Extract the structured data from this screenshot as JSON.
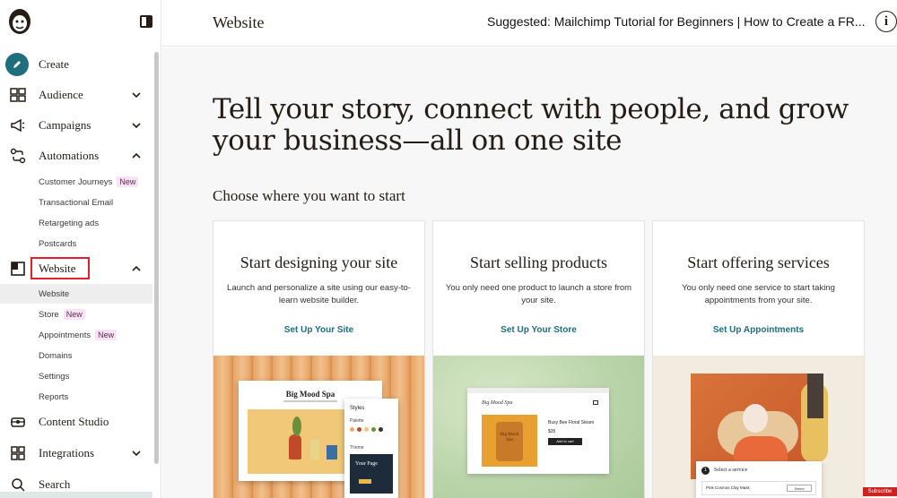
{
  "header": {
    "page_title": "Website",
    "suggested": "Suggested: Mailchimp Tutorial for Beginners | How to Create a FR...",
    "info_label": "i"
  },
  "sidebar": {
    "create": "Create",
    "audience": "Audience",
    "campaigns": "Campaigns",
    "automations": "Automations",
    "automation_items": [
      {
        "label": "Customer Journeys",
        "badge": "New"
      },
      {
        "label": "Transactional Email"
      },
      {
        "label": "Retargeting ads"
      },
      {
        "label": "Postcards"
      }
    ],
    "website": "Website",
    "website_items": [
      {
        "label": "Website"
      },
      {
        "label": "Store",
        "badge": "New"
      },
      {
        "label": "Appointments",
        "badge": "New"
      },
      {
        "label": "Domains"
      },
      {
        "label": "Settings"
      },
      {
        "label": "Reports"
      }
    ],
    "content_studio": "Content Studio",
    "integrations": "Integrations",
    "search": "Search"
  },
  "main": {
    "headline": "Tell your story, connect with people, and grow your business—all on one site",
    "subhead": "Choose where you want to start",
    "cards": [
      {
        "title": "Start designing your site",
        "desc": "Launch and personalize a site using our easy-to-learn website builder.",
        "link": "Set Up Your Site"
      },
      {
        "title": "Start selling products",
        "desc": "You only need one product to launch a store from your site.",
        "link": "Set Up Your Store"
      },
      {
        "title": "Start offering services",
        "desc": "You only need one service to start taking appointments from your site.",
        "link": "Set Up Appointments"
      }
    ],
    "preview1": {
      "brand": "Big Mood Spa",
      "styles": "Styles",
      "palette": "Palette",
      "theme": "Theme",
      "your_page": "Your Page"
    },
    "preview2": {
      "brand": "Big Mood Spa",
      "jar_text": "Big Mood Spa",
      "product": "Busy Bee Floral Steam",
      "price": "$35",
      "button": "Add to cart"
    },
    "preview3": {
      "step": "1",
      "select": "Select a service",
      "item": "Pink Cosmos Clay Mask",
      "button": "Select"
    }
  },
  "overlay": {
    "subscribe": "Subscribe"
  },
  "colors": {
    "accent": "#1e6e7d",
    "highlight_box": "#e0202a",
    "badge_bg": "#f7e3f3"
  }
}
